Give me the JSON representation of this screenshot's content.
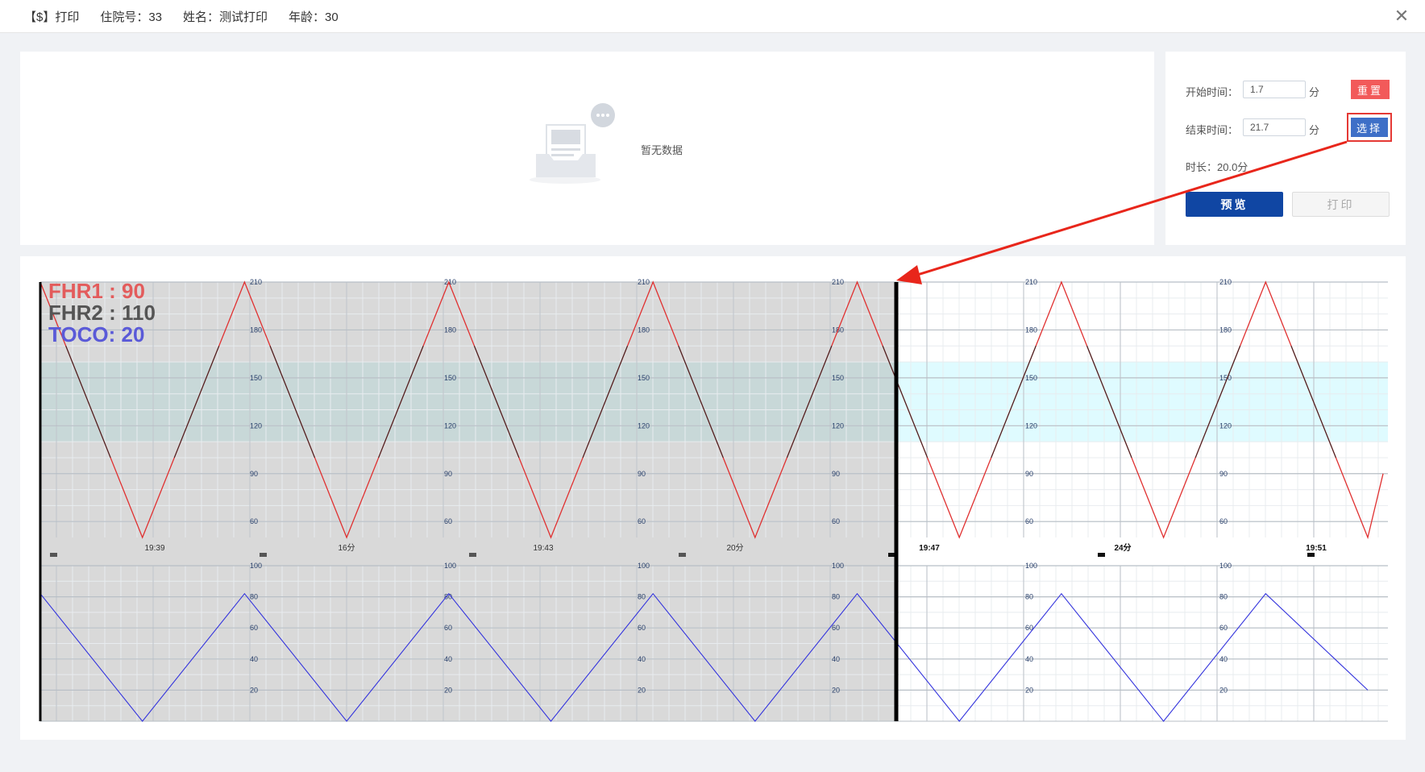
{
  "window": {
    "title": "【$】打印",
    "inpatient_no": "住院号：33",
    "name": "姓名：测试打印",
    "age": "年龄：30"
  },
  "empty": {
    "text": "暂无数据"
  },
  "controls": {
    "start_label": "开始时间：",
    "start_value": "1.7",
    "start_unit": "分",
    "end_label": "结束时间：",
    "end_value": "21.7",
    "end_unit": "分",
    "duration_text": "时长：20.0分",
    "reset_label": "重置",
    "select_label": "选择",
    "preview_label": "预览",
    "print_label": "打印"
  },
  "readouts": {
    "fhr1": "FHR1 : 90",
    "fhr2": "FHR2 : 110",
    "toco": "TOCO: 20"
  },
  "colors": {
    "fhr_line": "#e03030",
    "fhr2_line": "#222222",
    "toco_line": "#3333dd",
    "normal_band": "#dffbff",
    "selection_shade": "#d9d9d9",
    "annotation_red": "#e8261b",
    "fhr1_text": "#e35c5c",
    "fhr2_text": "#555555",
    "toco_text": "#5a5ad8"
  },
  "chart_data": [
    {
      "type": "line",
      "name_ref": "fhr",
      "y_ticks": [
        60,
        90,
        120,
        150,
        180,
        210
      ],
      "ylim": [
        50,
        210
      ],
      "normal_band": [
        110,
        160
      ],
      "x_labels": [
        "19:39",
        "16分",
        "19:43",
        "20分",
        "19:47",
        "24分",
        "19:51"
      ],
      "series": [
        {
          "x": [
            0,
            0.2,
            0.4,
            0.6,
            0.8,
            1.0,
            1.2,
            1.4,
            1.6,
            1.8,
            2.0,
            2.2,
            2.4,
            2.6,
            2.63
          ],
          "values": [
            210,
            50,
            210,
            50,
            210,
            50,
            210,
            50,
            210,
            50,
            210,
            50,
            210,
            50,
            90
          ]
        }
      ]
    },
    {
      "type": "line",
      "name_ref": "toco",
      "y_ticks": [
        20,
        40,
        60,
        80,
        100
      ],
      "ylim": [
        0,
        100
      ],
      "series": [
        {
          "x": [
            0,
            0.2,
            0.4,
            0.6,
            0.8,
            1.0,
            1.2,
            1.4,
            1.6,
            1.8,
            2.0,
            2.2,
            2.4,
            2.6
          ],
          "values": [
            82,
            0,
            82,
            0,
            82,
            0,
            82,
            0,
            82,
            0,
            82,
            0,
            82,
            20
          ]
        }
      ]
    }
  ]
}
